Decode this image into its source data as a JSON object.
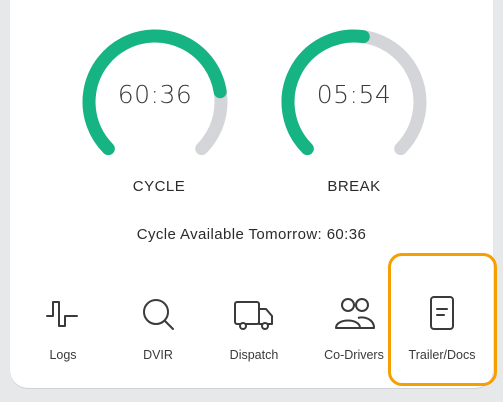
{
  "gauges": [
    {
      "value": "60:36",
      "label": "CYCLE",
      "fraction": 0.8,
      "color": "#16b383",
      "track": "#d3d5d8"
    },
    {
      "value": "05:54",
      "label": "BREAK",
      "fraction": 0.53,
      "color": "#16b383",
      "track": "#d3d5d8"
    }
  ],
  "cycle_available": "Cycle Available Tomorrow: 60:36",
  "nav": [
    {
      "label": "Logs",
      "icon": "logs-wave-icon"
    },
    {
      "label": "DVIR",
      "icon": "search-icon"
    },
    {
      "label": "Dispatch",
      "icon": "truck-icon"
    },
    {
      "label": "Co-Drivers",
      "icon": "users-icon"
    },
    {
      "label": "Trailer/Docs",
      "icon": "document-icon"
    }
  ],
  "highlight_color": "#f5a000"
}
